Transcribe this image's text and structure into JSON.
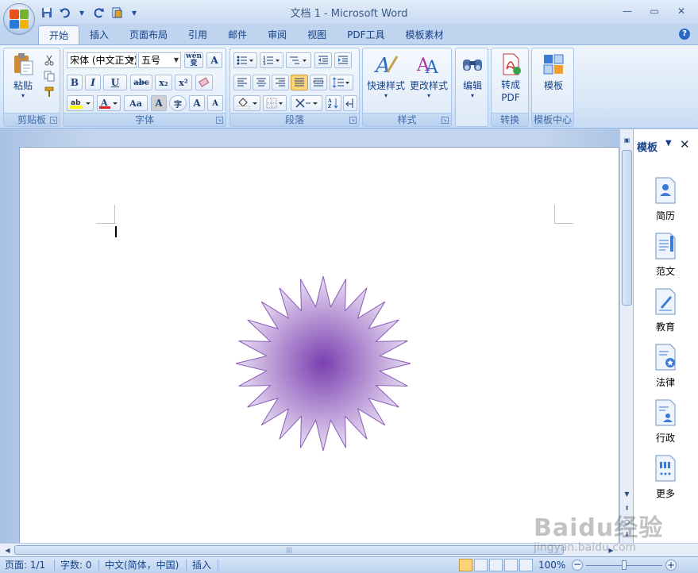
{
  "window": {
    "title": "文档 1 - Microsoft Word",
    "minimize": "—",
    "maximize": "▭",
    "close": "✕"
  },
  "qat": {
    "save_icon": "save-icon",
    "undo_icon": "undo-icon",
    "redo_icon": "redo-icon",
    "new_icon": "new-doc-icon",
    "more": "▾"
  },
  "tabs": [
    {
      "label": "开始",
      "active": true
    },
    {
      "label": "插入"
    },
    {
      "label": "页面布局"
    },
    {
      "label": "引用"
    },
    {
      "label": "邮件"
    },
    {
      "label": "审阅"
    },
    {
      "label": "视图"
    },
    {
      "label": "PDF工具"
    },
    {
      "label": "模板素材"
    }
  ],
  "ribbon": {
    "clipboard": {
      "label": "剪贴板",
      "paste": "粘贴"
    },
    "font": {
      "label": "字体",
      "font_name": "宋体 (中文正文)",
      "font_size": "五号",
      "wen": "wén",
      "bold": "B",
      "italic": "I",
      "underline": "U",
      "strike": "abc",
      "sub": "x₂",
      "sup": "x²",
      "case": "Aa",
      "char_border": "A",
      "enclose": "字",
      "grow": "A",
      "shrink": "A"
    },
    "paragraph": {
      "label": "段落"
    },
    "styles": {
      "label": "样式",
      "quick": "快速样式",
      "change": "更改样式"
    },
    "editing": {
      "label": "编辑"
    },
    "convert": {
      "label": "转换",
      "to_pdf_1": "转成",
      "to_pdf_2": "PDF"
    },
    "template_center": {
      "label": "模板中心",
      "template": "模板"
    }
  },
  "pane": {
    "title": "模板",
    "items": [
      {
        "label": "简历",
        "icon": "resume-icon"
      },
      {
        "label": "范文",
        "icon": "sample-essay-icon"
      },
      {
        "label": "教育",
        "icon": "education-icon"
      },
      {
        "label": "法律",
        "icon": "law-icon"
      },
      {
        "label": "行政",
        "icon": "admin-icon"
      },
      {
        "label": "更多",
        "icon": "more-icon"
      }
    ]
  },
  "document": {
    "shape": "24-point-star",
    "shape_fill_center": "#7b3fb0",
    "shape_fill_edge": "#e9def3",
    "shape_stroke": "#8a5cb8"
  },
  "status": {
    "page": "页面: 1/1",
    "words": "字数: 0",
    "language": "中文(简体，中国)",
    "mode": "插入",
    "zoom": "100%"
  },
  "watermark": {
    "logo": "Baidu经验",
    "url": "jingyan.baidu.com"
  },
  "colors": {
    "accent": "#15428b",
    "ribbon": "#dde9f8",
    "highlight": "#fcd47a"
  }
}
